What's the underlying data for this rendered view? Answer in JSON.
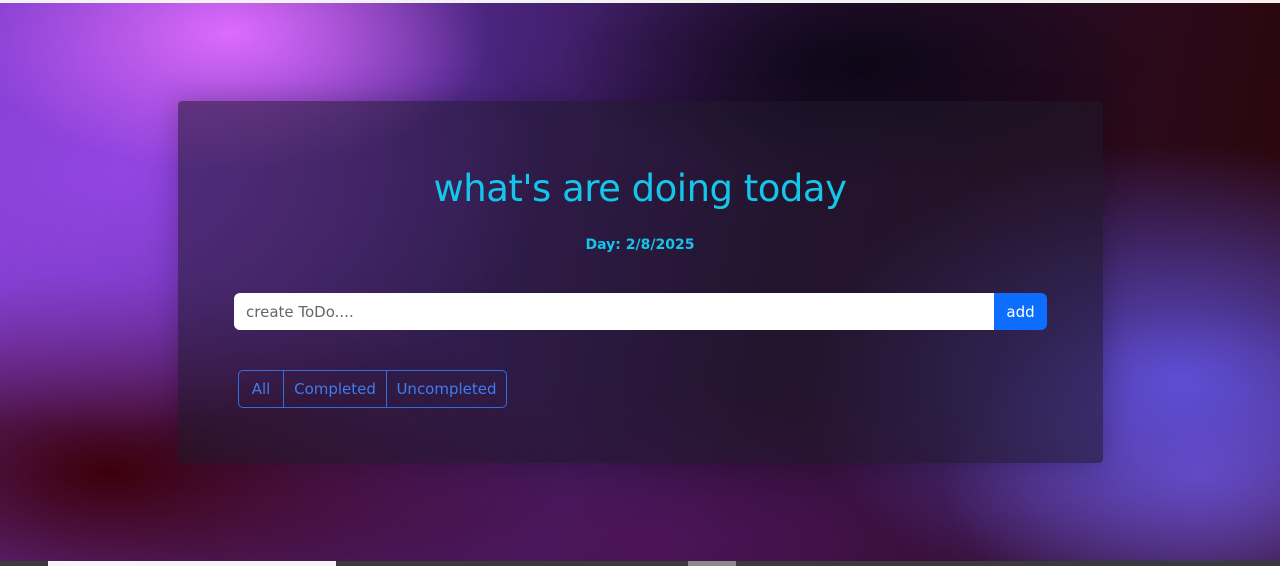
{
  "header": {
    "title": "what's are doing today",
    "date_label": "Day: 2/8/2025"
  },
  "todo_form": {
    "input_placeholder": "create ToDo....",
    "input_value": "",
    "add_label": "add"
  },
  "filters": {
    "all_label": "All",
    "completed_label": "Completed",
    "uncompleted_label": "Uncompleted"
  },
  "colors": {
    "accent_cyan": "#13c6ea",
    "primary_blue": "#0d6efd"
  }
}
